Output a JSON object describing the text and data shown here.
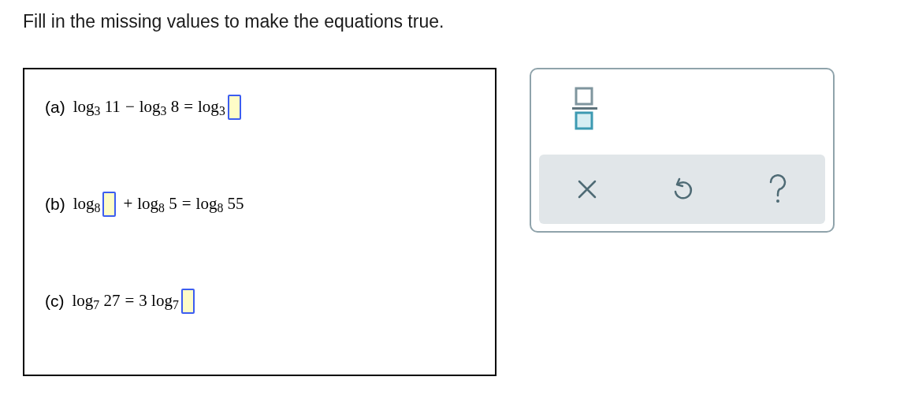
{
  "instruction": "Fill in the missing values to make the equations true.",
  "problems": [
    {
      "label": "(a)",
      "terms": [
        {
          "kind": "text",
          "text": "log$_{3}$ 11"
        },
        {
          "kind": "op",
          "text": "−"
        },
        {
          "kind": "text",
          "text": "log$_{3}$ 8"
        },
        {
          "kind": "op",
          "text": "="
        },
        {
          "kind": "text",
          "text": "log$_{3}$"
        },
        {
          "kind": "blank"
        }
      ]
    },
    {
      "label": "(b)",
      "terms": [
        {
          "kind": "text",
          "text": "log$_{8}$"
        },
        {
          "kind": "blank"
        },
        {
          "kind": "op",
          "text": "+"
        },
        {
          "kind": "text",
          "text": "log$_{8}$ 5"
        },
        {
          "kind": "op",
          "text": "="
        },
        {
          "kind": "text",
          "text": "log$_{8}$ 55"
        }
      ]
    },
    {
      "label": "(c)",
      "terms": [
        {
          "kind": "text",
          "text": "log$_{7}$ 27"
        },
        {
          "kind": "op",
          "text": "="
        },
        {
          "kind": "text",
          "text": "3 log$_{7}$"
        },
        {
          "kind": "blank"
        }
      ]
    }
  ]
}
